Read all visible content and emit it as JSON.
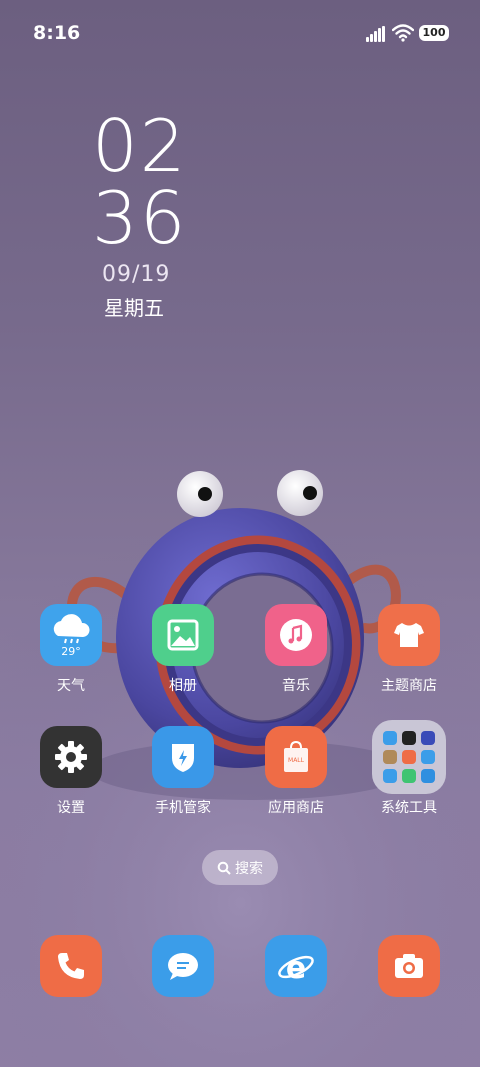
{
  "status_bar": {
    "time": "8:16",
    "battery": "100",
    "icons": [
      "signal-icon",
      "wifi-icon",
      "battery-icon"
    ]
  },
  "clock_widget": {
    "hour": "02",
    "minute": "36",
    "date": "09/19",
    "weekday": "星期五"
  },
  "apps_row1": [
    {
      "label": "天气",
      "icon": "weather-icon",
      "temp": "29°",
      "color": "#3fa3ec"
    },
    {
      "label": "相册",
      "icon": "gallery-icon",
      "color": "#4fcf8c"
    },
    {
      "label": "音乐",
      "icon": "music-icon",
      "color": "#f0628a"
    },
    {
      "label": "主题商店",
      "icon": "theme-store-icon",
      "color": "#ef6f4a"
    }
  ],
  "apps_row2": [
    {
      "label": "设置",
      "icon": "settings-icon",
      "color": "#333333"
    },
    {
      "label": "手机管家",
      "icon": "security-icon",
      "color": "#3a98e8"
    },
    {
      "label": "应用商店",
      "icon": "app-store-icon",
      "bag_text": "MALL",
      "color": "#ef6c46"
    },
    {
      "label": "系统工具",
      "icon": "folder-icon",
      "color": "#c9c6d6"
    }
  ],
  "search": {
    "label": "搜索"
  },
  "dock": [
    {
      "icon": "phone-icon",
      "color": "#ef6c46"
    },
    {
      "icon": "messages-icon",
      "color": "#3b9de9"
    },
    {
      "icon": "browser-icon",
      "color": "#3b9de9"
    },
    {
      "icon": "camera-icon",
      "color": "#ef6c46"
    }
  ]
}
